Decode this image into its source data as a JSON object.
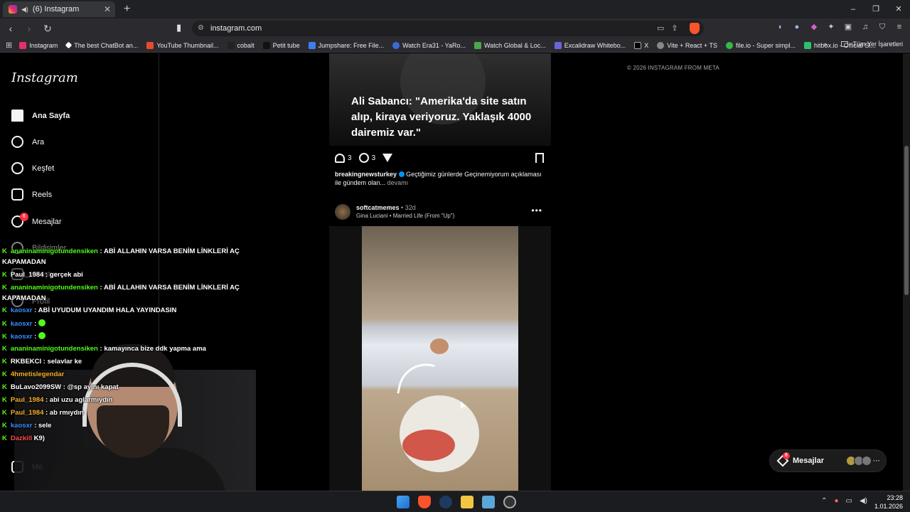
{
  "browser": {
    "tab_title": "(6) Instagram",
    "new_tab": "+",
    "url": "instagram.com",
    "window_controls": [
      "–",
      "❐",
      "✕"
    ],
    "bookmarks": [
      "Instagram",
      "The best ChatBot an...",
      "YouTube Thumbnail...",
      "cobalt",
      "Petit tube",
      "Jumpshare: Free File...",
      "Watch Era31 - YaRo...",
      "Watch Global & Loc...",
      "Excalidraw Whitebo...",
      "X",
      "Vite + React + TS",
      "file.io - Super simpl...",
      "hitbox.io - Official Si..."
    ],
    "bookmarks_overflow": "»",
    "all_bookmarks": "Tüm Yer İşaretleri"
  },
  "sidebar": {
    "logo": "Instagram",
    "items": [
      {
        "label": "Ana Sayfa",
        "icon": "home-icon"
      },
      {
        "label": "Ara",
        "icon": "search-icon"
      },
      {
        "label": "Keşfet",
        "icon": "compass-icon"
      },
      {
        "label": "Reels",
        "icon": "reels-icon"
      },
      {
        "label": "Mesajlar",
        "icon": "messenger-icon",
        "badge": "6"
      },
      {
        "label": "Bildirimler",
        "icon": "heart-icon"
      },
      {
        "label": "Oluştur",
        "icon": "plus-icon"
      },
      {
        "label": "Profil",
        "icon": "avatar-icon"
      },
      {
        "label": "Me",
        "icon": "menu-icon"
      }
    ]
  },
  "post1": {
    "headline": "Ali Sabancı: \"Amerika'da site satın alıp, kiraya veriyoruz. Yaklaşık 4000 dairemiz var.\"",
    "likes": "3",
    "comments": "3",
    "username": "breakingnewsturkey",
    "caption_text": "Geçtiğimiz günlerde Geçinemiyorum açıklaması ile gündem olan...",
    "more": "devamı"
  },
  "post2": {
    "username": "softcatmemes",
    "age": "32d",
    "audio": "Gina Luciani • Married Life (From \"Up\")",
    "options": "•••"
  },
  "footer": "© 2026 INSTAGRAM FROM META",
  "messages_pill": {
    "label": "Mesajlar",
    "badge": "6",
    "more": "···"
  },
  "chat": [
    {
      "user": "ananinaminigotundensiken",
      "color": "green",
      "text": " : ABİ ALLAHIN VARSA BENİM LİNKLERİ AÇ"
    },
    {
      "user": "",
      "color": "white",
      "text": "KAPAMADAN"
    },
    {
      "user": "Paul_1984",
      "color": "white",
      "text": " : gerçek abi"
    },
    {
      "user": "ananinaminigotundensiken",
      "color": "green",
      "text": " : ABİ ALLAHIN VARSA BENİM LİNKLERİ AÇ"
    },
    {
      "user": "",
      "color": "white",
      "text": "KAPAMADAN"
    },
    {
      "user": "kaosxr",
      "color": "blue",
      "text": " : ABİ UYUDUM UYANDIM HALA YAYINDASIN"
    },
    {
      "user": "kaosxr",
      "color": "blue",
      "text": " : "
    },
    {
      "user": "kaosxr",
      "color": "blue",
      "text": " : "
    },
    {
      "user": "ananinaminigotundensiken",
      "color": "green",
      "text": " : kamayınca bize ddk yapma ama"
    },
    {
      "user": "RKBEKCI",
      "color": "white",
      "text": " : selavlar ke"
    },
    {
      "user": "4hmetislegendar",
      "color": "yellow",
      "text": ""
    },
    {
      "user": "BuLavo2099SW",
      "color": "white",
      "text": " : @sp                       ayını kapat"
    },
    {
      "user": "Paul_1984",
      "color": "yellow",
      "text": " : abi uzu                            aglarmıydın"
    },
    {
      "user": "Paul_1984",
      "color": "yellow",
      "text": " : ab                                   rmıydın"
    },
    {
      "user": "kaosxr",
      "color": "blue",
      "text": " : sele"
    },
    {
      "user": "Dazkill",
      "color": "red",
      "text": "                                                   K9)"
    }
  ],
  "clock": {
    "time": "23:28",
    "date": "1.01.2026"
  }
}
